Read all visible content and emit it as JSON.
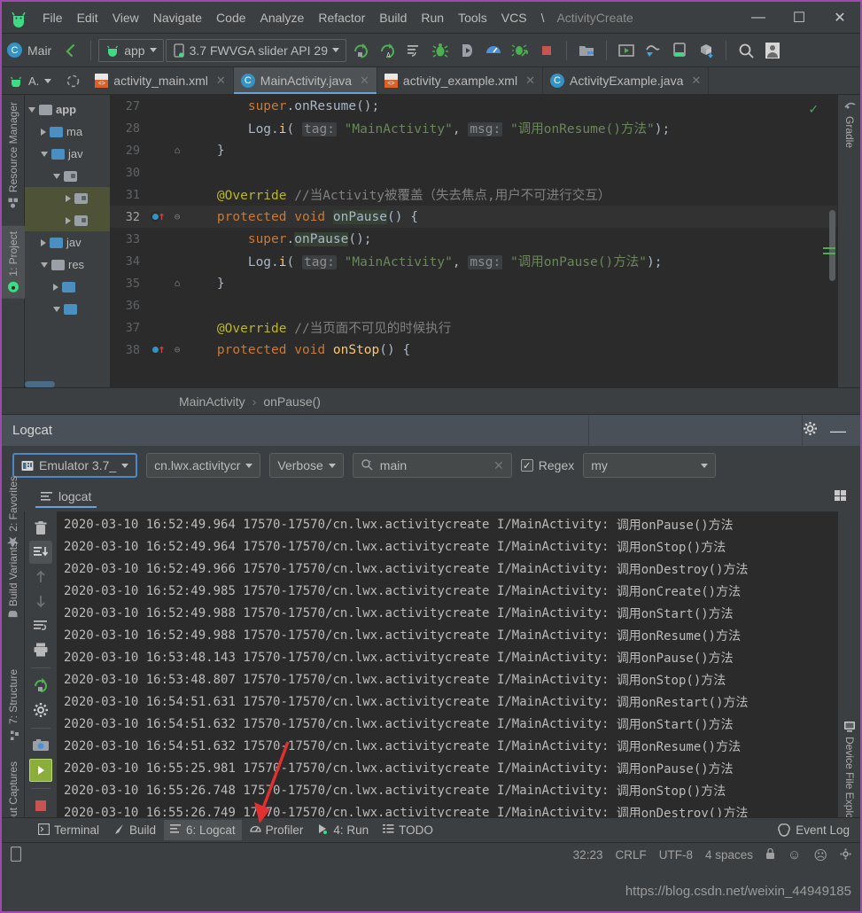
{
  "window": {
    "title": "ActivityCreate",
    "menus": [
      {
        "label": "File",
        "accel": "F"
      },
      {
        "label": "Edit",
        "accel": "E"
      },
      {
        "label": "View",
        "accel": "V"
      },
      {
        "label": "Navigate",
        "accel": "N"
      },
      {
        "label": "Code",
        "accel": "C"
      },
      {
        "label": "Analyze",
        "accel": "z"
      },
      {
        "label": "Refactor",
        "accel": "R"
      },
      {
        "label": "Build",
        "accel": "B"
      },
      {
        "label": "Run",
        "accel": "u"
      },
      {
        "label": "Tools",
        "accel": "T"
      },
      {
        "label": "VCS",
        "accel": "S"
      },
      {
        "label": "\\",
        "accel": ""
      }
    ],
    "minimize": "—",
    "maximize": "☐",
    "close": "✕"
  },
  "toolbar": {
    "breadcrumb_icon": "C",
    "breadcrumb_text": "Mair",
    "module_combo": "app",
    "device_combo": "3.7  FWVGA slider API 29",
    "icons": [
      {
        "name": "run-icon",
        "title": "Run"
      },
      {
        "name": "run-anything-icon",
        "title": "Run with Coverage"
      },
      {
        "name": "apply-changes-icon",
        "title": "Apply Changes"
      },
      {
        "name": "debug-icon",
        "title": "Debug"
      },
      {
        "name": "attach-debugger-icon",
        "title": "Attach Debugger"
      },
      {
        "name": "profiler-icon",
        "title": "Profile"
      },
      {
        "name": "debug-app-icon",
        "title": "Debug App"
      },
      {
        "name": "stop-icon",
        "title": "Stop"
      },
      {
        "name": "sdk-manager-icon",
        "title": "SDK Manager"
      },
      {
        "name": "avd-manager-icon",
        "title": "AVD Manager"
      },
      {
        "name": "sync-gradle-icon",
        "title": "Sync Project"
      },
      {
        "name": "layout-inspector-icon",
        "title": "Layout Inspector"
      },
      {
        "name": "device-manager-icon",
        "title": "Device Manager"
      },
      {
        "name": "search-icon",
        "title": "Search Everywhere"
      },
      {
        "name": "avatar-icon",
        "title": "Account"
      }
    ]
  },
  "tabs": {
    "left_label": "A.",
    "items": [
      {
        "label": "activity_main.xml",
        "icon": "xml-file-icon",
        "active": false
      },
      {
        "label": "MainActivity.java",
        "icon": "java-class-icon",
        "active": true
      },
      {
        "label": "activity_example.xml",
        "icon": "xml-file-icon",
        "active": false
      },
      {
        "label": "ActivityExample.java",
        "icon": "java-class-icon",
        "active": false
      }
    ],
    "close_glyph": "✕"
  },
  "sidebar_left": [
    {
      "label": "Resource Manager",
      "icon": "resource-manager-icon",
      "selected": false
    },
    {
      "label": "1: Project",
      "icon": "project-icon",
      "selected": true
    },
    {
      "label": "2: Favorites",
      "icon": "star-icon",
      "selected": false
    },
    {
      "label": "Build Variants",
      "icon": "android-icon",
      "selected": false
    },
    {
      "label": "7: Structure",
      "icon": "structure-icon",
      "selected": false
    },
    {
      "label": "Layout Captures",
      "icon": "layout-captures-icon",
      "selected": false
    }
  ],
  "sidebar_right": [
    {
      "label": "Gradle",
      "icon": "gradle-icon"
    },
    {
      "label": "Device File Explorer",
      "icon": "device-file-explorer-icon"
    }
  ],
  "project_tree": [
    {
      "label": "app",
      "depth": 0,
      "open": true,
      "icon": "module-folder-icon",
      "highlight": false
    },
    {
      "label": "ma",
      "depth": 1,
      "open": false,
      "icon": "folder-icon",
      "highlight": false
    },
    {
      "label": "jav",
      "depth": 1,
      "open": true,
      "icon": "folder-icon",
      "highlight": false
    },
    {
      "label": "",
      "depth": 2,
      "open": true,
      "icon": "package-icon",
      "highlight": false
    },
    {
      "label": "",
      "depth": 3,
      "open": false,
      "icon": "package-icon",
      "highlight": true
    },
    {
      "label": "",
      "depth": 3,
      "open": false,
      "icon": "package-icon",
      "highlight": true
    },
    {
      "label": "jav",
      "depth": 1,
      "open": false,
      "icon": "generated-folder-icon",
      "highlight": false
    },
    {
      "label": "res",
      "depth": 1,
      "open": true,
      "icon": "res-folder-icon",
      "highlight": false
    },
    {
      "label": "",
      "depth": 2,
      "open": false,
      "icon": "folder-icon",
      "highlight": false
    },
    {
      "label": "",
      "depth": 2,
      "open": true,
      "icon": "folder-icon",
      "highlight": false
    }
  ],
  "editor": {
    "lines": [
      {
        "num": "27",
        "marker": "",
        "fold": "",
        "current": false,
        "segments": [
          {
            "t": "        ",
            "c": "pln"
          },
          {
            "t": "super",
            "c": "kw"
          },
          {
            "t": ".onResume();",
            "c": "pln"
          }
        ]
      },
      {
        "num": "28",
        "marker": "",
        "fold": "",
        "current": false,
        "segments": [
          {
            "t": "        ",
            "c": "pln"
          },
          {
            "t": "Log",
            "c": "pln"
          },
          {
            "t": ".",
            "c": "pln"
          },
          {
            "t": "i",
            "c": "fn"
          },
          {
            "t": "( ",
            "c": "pln"
          },
          {
            "t": "tag:",
            "c": "hint"
          },
          {
            "t": " ",
            "c": "pln"
          },
          {
            "t": "\"MainActivity\"",
            "c": "str"
          },
          {
            "t": ", ",
            "c": "pln"
          },
          {
            "t": "msg:",
            "c": "hint"
          },
          {
            "t": " ",
            "c": "pln"
          },
          {
            "t": "\"调用onResume()方法\"",
            "c": "str"
          },
          {
            "t": ");",
            "c": "pln"
          }
        ]
      },
      {
        "num": "29",
        "marker": "",
        "fold": "⌂",
        "current": false,
        "segments": [
          {
            "t": "    }",
            "c": "pln"
          }
        ]
      },
      {
        "num": "30",
        "marker": "",
        "fold": "",
        "current": false,
        "segments": [
          {
            "t": "",
            "c": "pln"
          }
        ]
      },
      {
        "num": "31",
        "marker": "",
        "fold": "",
        "current": false,
        "segments": [
          {
            "t": "    ",
            "c": "pln"
          },
          {
            "t": "@Override",
            "c": "ann"
          },
          {
            "t": " ",
            "c": "pln"
          },
          {
            "t": "//当Activity被覆盖（失去焦点,用户不可进行交互）",
            "c": "cmt"
          }
        ]
      },
      {
        "num": "32",
        "marker": "override-method-marker",
        "fold": "⊖",
        "current": true,
        "segments": [
          {
            "t": "    ",
            "c": "pln"
          },
          {
            "t": "protected",
            "c": "kw"
          },
          {
            "t": " ",
            "c": "pln"
          },
          {
            "t": "void",
            "c": "kw"
          },
          {
            "t": " ",
            "c": "pln"
          },
          {
            "t": "onPause",
            "c": "sel-bg pln"
          },
          {
            "t": "() {",
            "c": "pln"
          }
        ]
      },
      {
        "num": "33",
        "marker": "",
        "fold": "",
        "current": false,
        "segments": [
          {
            "t": "        ",
            "c": "pln"
          },
          {
            "t": "super",
            "c": "kw"
          },
          {
            "t": ".",
            "c": "pln"
          },
          {
            "t": "onPause",
            "c": "sel-bg pln"
          },
          {
            "t": "();",
            "c": "pln"
          }
        ]
      },
      {
        "num": "34",
        "marker": "",
        "fold": "",
        "current": false,
        "segments": [
          {
            "t": "        ",
            "c": "pln"
          },
          {
            "t": "Log",
            "c": "pln"
          },
          {
            "t": ".",
            "c": "pln"
          },
          {
            "t": "i",
            "c": "fn"
          },
          {
            "t": "( ",
            "c": "pln"
          },
          {
            "t": "tag:",
            "c": "hint"
          },
          {
            "t": " ",
            "c": "pln"
          },
          {
            "t": "\"MainActivity\"",
            "c": "str"
          },
          {
            "t": ", ",
            "c": "pln"
          },
          {
            "t": "msg:",
            "c": "hint"
          },
          {
            "t": " ",
            "c": "pln"
          },
          {
            "t": "\"调用onPause()方法\"",
            "c": "str"
          },
          {
            "t": ");",
            "c": "pln"
          }
        ]
      },
      {
        "num": "35",
        "marker": "",
        "fold": "⌂",
        "current": false,
        "segments": [
          {
            "t": "    }",
            "c": "pln"
          }
        ]
      },
      {
        "num": "36",
        "marker": "",
        "fold": "",
        "current": false,
        "segments": [
          {
            "t": "",
            "c": "pln"
          }
        ]
      },
      {
        "num": "37",
        "marker": "",
        "fold": "",
        "current": false,
        "segments": [
          {
            "t": "    ",
            "c": "pln"
          },
          {
            "t": "@Override",
            "c": "ann"
          },
          {
            "t": " ",
            "c": "pln"
          },
          {
            "t": "//当页面不可见的时候执行",
            "c": "cmt"
          }
        ]
      },
      {
        "num": "38",
        "marker": "override-method-marker",
        "fold": "⊖",
        "current": false,
        "segments": [
          {
            "t": "    ",
            "c": "pln"
          },
          {
            "t": "protected",
            "c": "kw"
          },
          {
            "t": " ",
            "c": "pln"
          },
          {
            "t": "void",
            "c": "kw"
          },
          {
            "t": " ",
            "c": "pln"
          },
          {
            "t": "onStop",
            "c": "fn"
          },
          {
            "t": "() {",
            "c": "pln"
          }
        ]
      }
    ],
    "inspection_status": "✓"
  },
  "breadcrumbs": {
    "class": "MainActivity",
    "separator": "›",
    "method": "onPause()"
  },
  "logcat": {
    "title": "Logcat",
    "settings_icon": "gear-icon",
    "minimize_icon": "minimize-icon",
    "device": "Emulator 3.7_",
    "process": "cn.lwx.activitycr",
    "level": "Verbose",
    "search_value": "main",
    "search_clear": "✕",
    "regex_label": "Regex",
    "regex_checked": "✓",
    "filter": "my",
    "tab_label": "logcat",
    "rail_icons": [
      {
        "name": "clear-logcat-icon",
        "selected": false
      },
      {
        "name": "scroll-to-end-icon",
        "selected": true
      },
      {
        "name": "up-arrow-icon",
        "selected": false
      },
      {
        "name": "down-arrow-icon",
        "selected": false
      },
      {
        "name": "soft-wrap-icon",
        "selected": false
      },
      {
        "name": "print-icon",
        "selected": false
      },
      {
        "name": "restart-icon",
        "selected": false
      },
      {
        "name": "settings-icon",
        "selected": false
      },
      {
        "name": "screenshot-icon",
        "selected": false
      },
      {
        "name": "screen-record-icon",
        "selected": false
      },
      {
        "name": "stop-icon",
        "selected": false
      }
    ],
    "rows": [
      {
        "date": "2020-03-10",
        "time": "16:52:49.964",
        "pid": "17570-17570",
        "pkg": "cn.lwx.activitycreate",
        "tag": "I/MainActivity:",
        "msg": "调用onPause()方法"
      },
      {
        "date": "2020-03-10",
        "time": "16:52:49.964",
        "pid": "17570-17570",
        "pkg": "cn.lwx.activitycreate",
        "tag": "I/MainActivity:",
        "msg": "调用onStop()方法"
      },
      {
        "date": "2020-03-10",
        "time": "16:52:49.966",
        "pid": "17570-17570",
        "pkg": "cn.lwx.activitycreate",
        "tag": "I/MainActivity:",
        "msg": "调用onDestroy()方法"
      },
      {
        "date": "2020-03-10",
        "time": "16:52:49.985",
        "pid": "17570-17570",
        "pkg": "cn.lwx.activitycreate",
        "tag": "I/MainActivity:",
        "msg": "调用onCreate()方法"
      },
      {
        "date": "2020-03-10",
        "time": "16:52:49.988",
        "pid": "17570-17570",
        "pkg": "cn.lwx.activitycreate",
        "tag": "I/MainActivity:",
        "msg": "调用onStart()方法"
      },
      {
        "date": "2020-03-10",
        "time": "16:52:49.988",
        "pid": "17570-17570",
        "pkg": "cn.lwx.activitycreate",
        "tag": "I/MainActivity:",
        "msg": "调用onResume()方法"
      },
      {
        "date": "2020-03-10",
        "time": "16:53:48.143",
        "pid": "17570-17570",
        "pkg": "cn.lwx.activitycreate",
        "tag": "I/MainActivity:",
        "msg": "调用onPause()方法"
      },
      {
        "date": "2020-03-10",
        "time": "16:53:48.807",
        "pid": "17570-17570",
        "pkg": "cn.lwx.activitycreate",
        "tag": "I/MainActivity:",
        "msg": "调用onStop()方法"
      },
      {
        "date": "2020-03-10",
        "time": "16:54:51.631",
        "pid": "17570-17570",
        "pkg": "cn.lwx.activitycreate",
        "tag": "I/MainActivity:",
        "msg": "调用onRestart()方法"
      },
      {
        "date": "2020-03-10",
        "time": "16:54:51.632",
        "pid": "17570-17570",
        "pkg": "cn.lwx.activitycreate",
        "tag": "I/MainActivity:",
        "msg": "调用onStart()方法"
      },
      {
        "date": "2020-03-10",
        "time": "16:54:51.632",
        "pid": "17570-17570",
        "pkg": "cn.lwx.activitycreate",
        "tag": "I/MainActivity:",
        "msg": "调用onResume()方法"
      },
      {
        "date": "2020-03-10",
        "time": "16:55:25.981",
        "pid": "17570-17570",
        "pkg": "cn.lwx.activitycreate",
        "tag": "I/MainActivity:",
        "msg": "调用onPause()方法"
      },
      {
        "date": "2020-03-10",
        "time": "16:55:26.748",
        "pid": "17570-17570",
        "pkg": "cn.lwx.activitycreate",
        "tag": "I/MainActivity:",
        "msg": "调用onStop()方法"
      },
      {
        "date": "2020-03-10",
        "time": "16:55:26.749",
        "pid": "17570-17570",
        "pkg": "cn.lwx.activitycreate",
        "tag": "I/MainActivity:",
        "msg": "调用onDestroy()方法"
      }
    ]
  },
  "toolwindows": [
    {
      "label": "Terminal",
      "accel": "",
      "icon": "terminal-icon",
      "selected": false
    },
    {
      "label": "Build",
      "accel": "",
      "icon": "build-icon",
      "selected": false
    },
    {
      "label": "6: Logcat",
      "accel": "6",
      "icon": "logcat-icon",
      "selected": true
    },
    {
      "label": "Profiler",
      "accel": "",
      "icon": "profiler-icon",
      "selected": false
    },
    {
      "label": "4: Run",
      "accel": "4",
      "icon": "run-icon",
      "selected": false
    },
    {
      "label": "TODO",
      "accel": "",
      "icon": "todo-icon",
      "selected": false
    }
  ],
  "event_log": {
    "label": "Event Log",
    "icon": "event-log-icon"
  },
  "statusbar": {
    "caret": "32:23",
    "line_sep": "CRLF",
    "encoding": "UTF-8",
    "indent": "4 spaces",
    "lock_icon": "lock-icon",
    "happy_icon": "☺",
    "sad_icon": "☹"
  },
  "watermark": "https://blog.csdn.net/weixin_44949185",
  "colors": {
    "accent_blue": "#4a88c7",
    "android_green": "#3ddc84",
    "stop_red": "#c75450",
    "arrow_red": "#e03030",
    "window_border": "#a04ab0"
  }
}
